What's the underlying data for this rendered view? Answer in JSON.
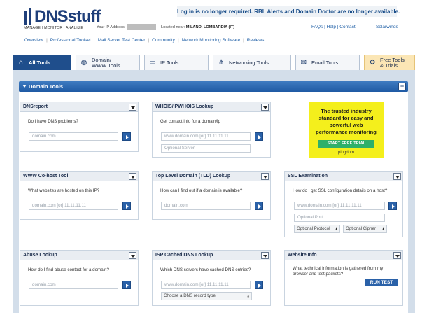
{
  "header": {
    "logo_main": "DNS",
    "logo_accent": "stuff",
    "logo_tagline": "MANAGE | MONITOR | ANALYZE",
    "ip_label": "Your IP Address:",
    "location_label": "Located near:",
    "location_value": "MILANO, LOMBARDIA (IT)",
    "notice": "Log in is no longer required. RBL Alerts and Domain Doctor are no longer available.",
    "links": [
      "FAQs",
      "Help",
      "Contact"
    ],
    "brand_link": "Solarwinds"
  },
  "nav": {
    "items": [
      "Overview",
      "Professional Toolset",
      "Mail Server Test Center",
      "Community",
      "Network Monitoring Software",
      "Reviews"
    ]
  },
  "tabs": [
    {
      "label": "All Tools",
      "icon": "home-icon"
    },
    {
      "label": "Domain/\nWWW Tools",
      "icon": "globe-icon"
    },
    {
      "label": "IP Tools",
      "icon": "monitor-icon"
    },
    {
      "label": "Networking Tools",
      "icon": "network-icon"
    },
    {
      "label": "Email Tools",
      "icon": "envelope-icon"
    },
    {
      "label": "Free Tools\n& Trials",
      "icon": "gear-icon"
    }
  ],
  "section": {
    "title": "Domain Tools",
    "collapse": "−"
  },
  "cards": {
    "dnsreport": {
      "title": "DNSreport",
      "desc": "Do I have DNS problems?",
      "placeholder": "domain.com"
    },
    "whois": {
      "title": "WHOIS/IPWHOIS Lookup",
      "desc": "Get contact info for a domain/ip",
      "placeholder": "www.domain.com [or] 11.11.11.11",
      "placeholder2": "Optional Server"
    },
    "cohost": {
      "title": "WWW Co-host Tool",
      "desc": "What websites are hosted on this IP?",
      "placeholder": "domain.com [or] 11.11.11.11"
    },
    "tld": {
      "title": "Top Level Domain (TLD) Lookup",
      "desc": "How can I find out if a domain is available?",
      "placeholder": "domain.com"
    },
    "ssl": {
      "title": "SSL Examination",
      "desc": "How do I get SSL configuration details on a host?",
      "placeholder": "www.domain.com [or] 11.11.11.11",
      "placeholder2": "Optional Port",
      "select1": "Optional Protocol",
      "select2": "Optional Cipher"
    },
    "abuse": {
      "title": "Abuse Lookup",
      "desc": "How do I find abuse contact for a domain?",
      "placeholder": "domain.com"
    },
    "ispdns": {
      "title": "ISP Cached DNS Lookup",
      "desc": "Which DNS servers have cached DNS entries?",
      "placeholder": "www.domain.com [or] 11.11.11.11",
      "select": "Choose a DNS record type"
    },
    "webinfo": {
      "title": "Website Info",
      "desc1": "What technical information is gathered from my",
      "desc2": "browser and test packets?",
      "button": "RUN TEST"
    }
  },
  "ad": {
    "text": "The trusted industry standard for easy and powerful web performance monitoring",
    "button": "START FREE TRIAL",
    "brand": "pingdom"
  }
}
